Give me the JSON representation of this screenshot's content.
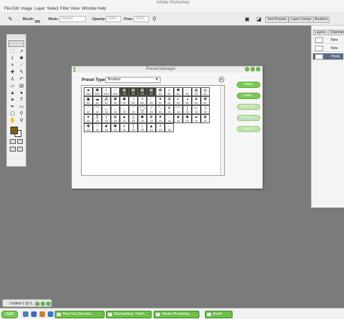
{
  "app": {
    "title": "Adobe Photoshop"
  },
  "menu": [
    "File",
    "Edit",
    "Image",
    "Layer",
    "Select",
    "Filter",
    "View",
    "Window",
    "Help"
  ],
  "options": {
    "brush_label": "Brush:",
    "brush_size": "300",
    "mode_label": "Mode:",
    "mode_value": "Normal",
    "opacity_label": "Opacity:",
    "opacity_value": "100%",
    "flow_label": "Flow:",
    "flow_value": "100%"
  },
  "palette_tabs": [
    "Tool Presets",
    "Layer Comps",
    "Brushes"
  ],
  "panel": {
    "tabs": [
      "Layers",
      "Channels"
    ],
    "rows": [
      {
        "name": "New",
        "selected": false
      },
      {
        "name": "New",
        "selected": false
      },
      {
        "name": "Photo",
        "selected": true
      }
    ]
  },
  "dialog": {
    "title": "Preset Manager",
    "preset_type_label": "Preset Type:",
    "preset_type_value": "Brushes",
    "buttons": [
      {
        "label": "Done",
        "enabled": true
      },
      {
        "label": "Load...",
        "enabled": true
      },
      {
        "label": "Save Set...",
        "enabled": false
      },
      {
        "label": "Rename...",
        "enabled": false
      },
      {
        "label": "Delete",
        "enabled": false
      }
    ],
    "brushes": [
      {
        "g": "●",
        "s": "250"
      },
      {
        "g": "✽",
        "s": "300"
      },
      {
        "g": "/",
        "s": "300"
      },
      {
        "g": "⟋",
        "s": "300"
      },
      {
        "g": "▦",
        "s": "25",
        "d": true
      },
      {
        "g": "▦",
        "s": "45",
        "d": true
      },
      {
        "g": "▦",
        "s": "131",
        "d": true
      },
      {
        "g": "▦",
        "s": "60",
        "d": true
      },
      {
        "g": "✿",
        "s": "60"
      },
      {
        "g": "☼",
        "s": "60"
      },
      {
        "g": "✺",
        "s": "60"
      },
      {
        "g": "◌",
        "s": "60"
      },
      {
        "g": "◍",
        "s": "20"
      },
      {
        "g": "◎",
        "s": "60"
      },
      {
        "g": "◉",
        "s": "60"
      },
      {
        "g": "☁",
        "s": "45"
      },
      {
        "g": "⁂",
        "s": "60"
      },
      {
        "g": "✾",
        "s": "45"
      },
      {
        "g": "✱",
        "s": "60"
      },
      {
        "g": "◔",
        "s": "45"
      },
      {
        "g": "✧",
        "s": "60"
      },
      {
        "g": "☄",
        "s": "45"
      },
      {
        "g": "✦",
        "s": "60"
      },
      {
        "g": "⊛",
        "s": "60"
      },
      {
        "g": "◐",
        "s": "45"
      },
      {
        "g": "◑",
        "s": "60"
      },
      {
        "g": "✵",
        "s": "60"
      },
      {
        "g": "❋",
        "s": "60"
      },
      {
        "g": "◜",
        "s": "12"
      },
      {
        "g": "◠",
        "s": "16"
      },
      {
        "g": "◡",
        "s": "15"
      },
      {
        "g": "◞",
        "s": "15"
      },
      {
        "g": "◟",
        "s": "15"
      },
      {
        "g": "◝",
        "s": "15"
      },
      {
        "g": "◯",
        "s": "15"
      },
      {
        "g": "∕",
        "s": "15"
      },
      {
        "g": "⟍",
        "s": "15"
      },
      {
        "g": "✕",
        "s": "15"
      },
      {
        "g": "◠",
        "s": "15"
      },
      {
        "g": "∫",
        "s": "15"
      },
      {
        "g": "⊂",
        "s": "15"
      },
      {
        "g": "⊃",
        "s": "15"
      },
      {
        "g": "✶",
        "s": "15"
      },
      {
        "g": "⁑",
        "s": "15"
      },
      {
        "g": "ℓ",
        "s": "15"
      },
      {
        "g": "⊕",
        "s": "15"
      },
      {
        "g": "♠",
        "s": "15"
      },
      {
        "g": "◇",
        "s": "15"
      },
      {
        "g": "✺",
        "s": "15"
      },
      {
        "g": "❄",
        "s": "15"
      },
      {
        "g": "✦",
        "s": "15"
      },
      {
        "g": "◦",
        "s": "15"
      },
      {
        "g": "★",
        "s": "15"
      },
      {
        "g": "✚",
        "s": "15"
      },
      {
        "g": "☙",
        "s": "15"
      },
      {
        "g": "❦",
        "s": "15"
      },
      {
        "g": "✤",
        "s": "15"
      },
      {
        "g": "⁘",
        "s": "15"
      },
      {
        "g": "♣",
        "s": "15"
      },
      {
        "g": "✱",
        "s": "15"
      },
      {
        "g": "⸙",
        "s": "15"
      },
      {
        "g": "⟆",
        "s": "15"
      },
      {
        "g": "♪",
        "s": "15"
      },
      {
        "g": "▲",
        "s": "15"
      },
      {
        "g": "•",
        "s": "15"
      },
      {
        "g": "·",
        "s": "15"
      }
    ]
  },
  "document": {
    "title": "Untitled-1 @ 6..."
  },
  "taskbar": {
    "start_label": "start",
    "tasks": [
      "New Text Docume...",
      "Blockwriting - Paint...",
      "Adobe Photoshop",
      "Brush"
    ]
  }
}
